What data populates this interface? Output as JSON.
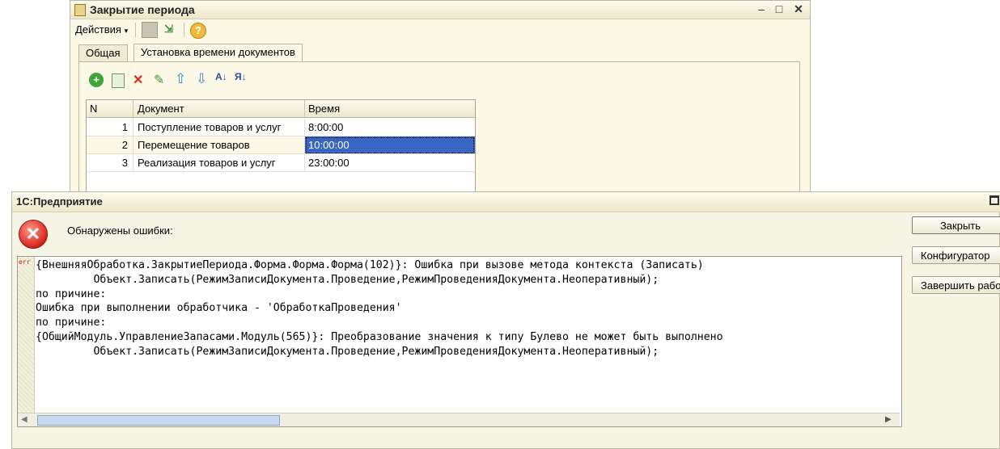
{
  "bg_window": {
    "title": "Закрытие периода",
    "actions_label": "Действия",
    "tabs": [
      "Общая",
      "Установка времени документов"
    ],
    "grid": {
      "columns": [
        "N",
        "Документ",
        "Время"
      ],
      "rows": [
        {
          "n": "1",
          "doc": "Поступление товаров и услуг",
          "time": "8:00:00"
        },
        {
          "n": "2",
          "doc": "Перемещение товаров",
          "time": "10:00:00"
        },
        {
          "n": "3",
          "doc": "Реализация товаров и услуг",
          "time": "23:00:00"
        }
      ]
    }
  },
  "error_window": {
    "title": "1С:Предприятие",
    "heading": "Обнаружены ошибки:",
    "err_marker": "err",
    "message_lines": [
      "{ВнешняяОбработка.ЗакрытиеПериода.Форма.Форма.Форма(102)}: Ошибка при вызове метода контекста (Записать)",
      "         Объект.Записать(РежимЗаписиДокумента.Проведение,РежимПроведенияДокумента.Неоперативный);",
      "по причине:",
      "Ошибка при выполнении обработчика - 'ОбработкаПроведения'",
      "по причине:",
      "{ОбщийМодуль.УправлениеЗапасами.Модуль(565)}: Преобразование значения к типу Булево не может быть выполнено",
      "         Объект.Записать(РежимЗаписиДокумента.Проведение,РежимПроведенияДокумента.Неоперативный);"
    ],
    "buttons": {
      "close": "Закрыть",
      "configurator": "Конфигуратор",
      "finish": "Завершить работу"
    }
  },
  "colors": {
    "selection": "#3865c4",
    "window_bg": "#fbf8e6",
    "error_red": "#d6241a"
  }
}
